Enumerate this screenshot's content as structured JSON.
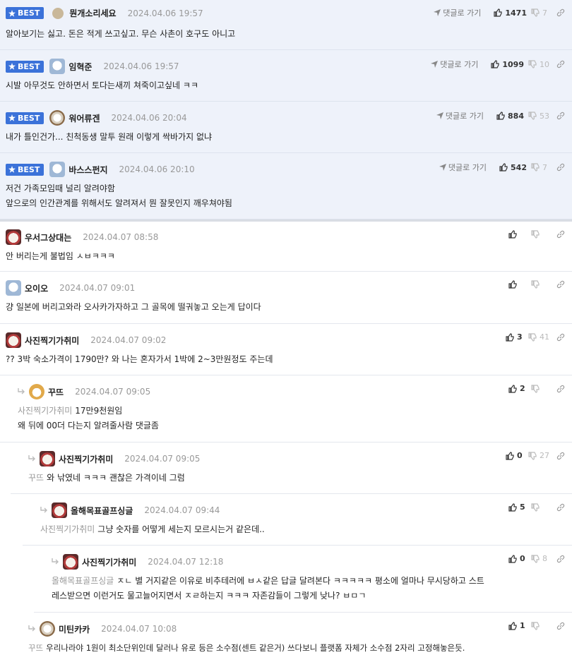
{
  "labels": {
    "best": "BEST",
    "goto_reply": "댓글로 가기"
  },
  "comments": [
    {
      "name": "뭔개소리세요",
      "date": "2024.04.06 19:57",
      "up": "1471",
      "down": "7",
      "lines": [
        "알아보기는 싫고. 돈은 적게 쓰고싶고. 무슨 사촌이 호구도 아니고"
      ]
    },
    {
      "name": "임혁준",
      "date": "2024.04.06 19:57",
      "up": "1099",
      "down": "10",
      "lines": [
        "시발 아무것도 안하면서 토다는새끼 쳐죽이고싶네 ㅋㅋ"
      ]
    },
    {
      "name": "워어류겐",
      "date": "2024.04.06 20:04",
      "up": "884",
      "down": "53",
      "lines": [
        "내가 틀인건가... 친척동생 말투 원래 이렇게 싹바가지 없냐"
      ]
    },
    {
      "name": "바스스펀지",
      "date": "2024.04.06 20:10",
      "up": "542",
      "down": "7",
      "lines": [
        "저건 가족모임때 널리 알려야함",
        "앞으로의 인간관계를 위해서도 알려져서 뭔 잘못인지 깨우쳐야됨"
      ]
    },
    {
      "name": "우서그상대는",
      "date": "2024.04.07 08:58",
      "up": "",
      "down": "",
      "lines": [
        "안 버리는게 불법임 ㅅㅂㅋㅋㅋ"
      ]
    },
    {
      "name": "오이오",
      "date": "2024.04.07 09:01",
      "up": "",
      "down": "",
      "lines": [
        "걍 일본에 버리고와라 오사카가자하고 그 골목에 떨궈놓고 오는게 답이다"
      ]
    },
    {
      "name": "사진찍기가취미",
      "date": "2024.04.07 09:02",
      "up": "3",
      "down": "41",
      "lines": [
        "?? 3박 숙소가격이 1790만? 와 나는 혼자가서 1박에 2~3만원정도 주는데"
      ]
    },
    {
      "name": "꾸뜨",
      "date": "2024.04.07 09:05",
      "up": "2",
      "down": "",
      "mention": "사진찍기가취미",
      "lines": [
        "17만9천원임",
        "왜 뒤에 00더 다는지 알려줄사람 댓글좀"
      ]
    },
    {
      "name": "사진찍기가취미",
      "date": "2024.04.07 09:05",
      "up": "0",
      "down": "27",
      "mention": "꾸뜨",
      "lines": [
        "와 낚였네 ㅋㅋㅋ 괜찮은 가격이네 그럼"
      ]
    },
    {
      "name": "올해목표골프싱글",
      "date": "2024.04.07 09:44",
      "up": "5",
      "down": "",
      "mention": "사진찍기가취미",
      "lines": [
        "그냥 숫자를 어떻게 세는지 모르시는거 같은데.."
      ]
    },
    {
      "name": "사진찍기가취미",
      "date": "2024.04.07 12:18",
      "up": "0",
      "down": "8",
      "mention": "올해목표골프싱글",
      "lines": [
        "ㅈㄴ 별 거지같은 이유로 비추테러에 ㅂㅅ같은 답글 달려본다 ㅋㅋㅋㅋㅋ 평소에 얼마나 무시당하고 스트",
        "레스받으면 이런거도 물고늘어지면서 ㅈㄹ하는지 ㅋㅋㅋ 자존감들이 그렇게 낮나? ㅂㅁㄱ"
      ]
    },
    {
      "name": "미틴카카",
      "date": "2024.04.07 10:08",
      "up": "1",
      "down": "",
      "mention": "꾸뜨",
      "lines": [
        "우리나라야 1원이 최소단위인데 달러나 유로 등은 소수점(센트 같은거) 쓰다보니 플랫폼 자체가 소수점 2자리 고정해놓은듯."
      ]
    }
  ]
}
